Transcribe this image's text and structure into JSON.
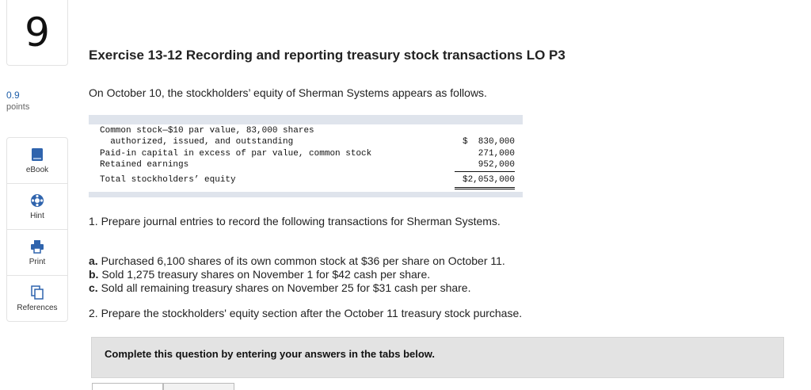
{
  "question": {
    "number": "9",
    "points_value": "0.9",
    "points_label": "points"
  },
  "tools": [
    {
      "label": "eBook",
      "icon": "book-icon"
    },
    {
      "label": "Hint",
      "icon": "hint-icon"
    },
    {
      "label": "Print",
      "icon": "print-icon"
    },
    {
      "label": "References",
      "icon": "references-icon"
    }
  ],
  "title": "Exercise 13-12 Recording and reporting treasury stock transactions LO P3",
  "intro": "On October 10, the stockholders’ equity of Sherman Systems appears as follows.",
  "equity_table": {
    "rows": [
      {
        "line1": "Common stock—$10 par value, 83,000 shares",
        "line2": "  authorized, issued, and outstanding",
        "amount": "$  830,000"
      },
      {
        "line1": "Paid-in capital in excess of par value, common stock",
        "amount": "271,000"
      },
      {
        "line1": "Retained earnings",
        "amount": "952,000"
      },
      {
        "line1": "Total stockholders’ equity",
        "amount": "$2,053,000"
      }
    ]
  },
  "q1": "1. Prepare journal entries to record the following transactions for Sherman Systems.",
  "items": [
    {
      "label": "a.",
      "text": " Purchased 6,100 shares of its own common stock at $36 per share on October 11."
    },
    {
      "label": "b.",
      "text": " Sold 1,275 treasury shares on November 1 for $42 cash per share."
    },
    {
      "label": "c.",
      "text": " Sold all remaining treasury shares on November 25 for $31 cash per share."
    }
  ],
  "q2": "2. Prepare the stockholders' equity section after the October 11 treasury stock purchase.",
  "complete_text": "Complete this question by entering your answers in the tabs below."
}
